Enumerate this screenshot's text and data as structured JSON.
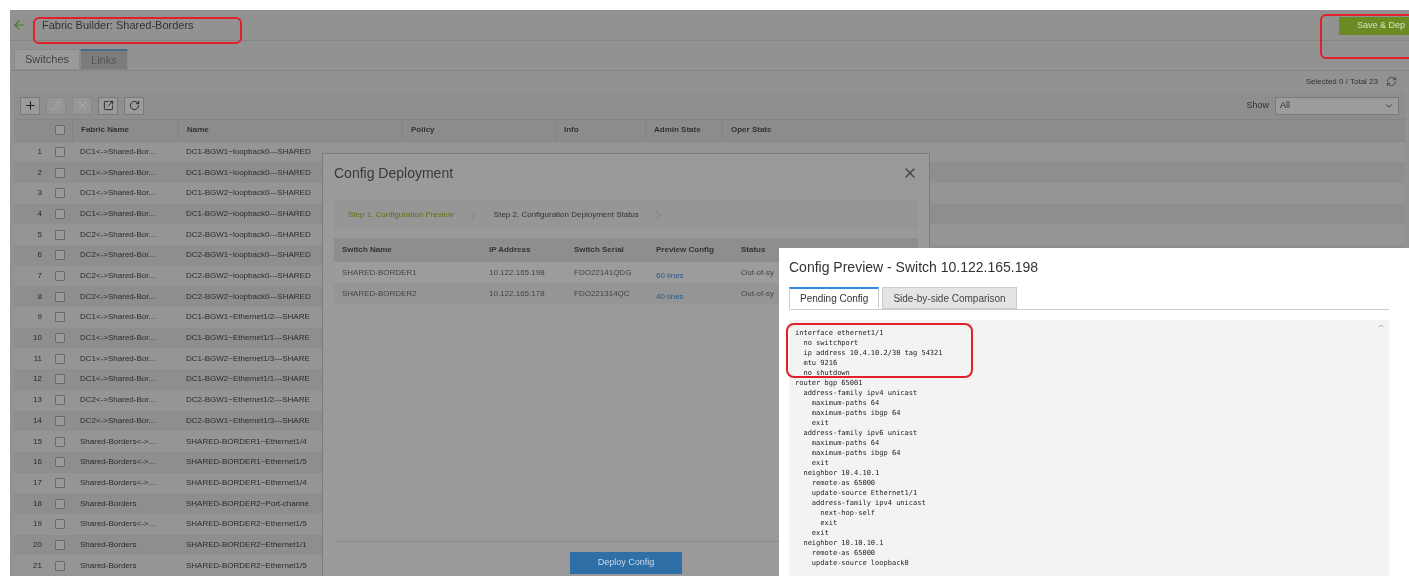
{
  "header": {
    "title": "Fabric Builder: Shared-Borders",
    "save_button": "Save & Dep"
  },
  "tabs": [
    {
      "label": "Switches",
      "selected": false
    },
    {
      "label": "Links",
      "selected": true
    }
  ],
  "summary": "Selected 0 / Total 23",
  "filter": {
    "label": "Show",
    "value": "All"
  },
  "table": {
    "columns": [
      "Fabric Name",
      "Name",
      "Policy",
      "Info",
      "Admin State",
      "Oper State"
    ],
    "select_all_checked": false,
    "rows": [
      {
        "index": "1",
        "checked": false,
        "fabric": "DC1<->Shared-Bor...",
        "name": "DC1-BGW1~loopback0---SHARED"
      },
      {
        "index": "2",
        "checked": false,
        "fabric": "DC1<->Shared-Bor...",
        "name": "DC1-BGW1~loopback0---SHARED"
      },
      {
        "index": "3",
        "checked": false,
        "fabric": "DC1<->Shared-Bor...",
        "name": "DC1-BGW2~loopback0---SHARED"
      },
      {
        "index": "4",
        "checked": false,
        "fabric": "DC1<->Shared-Bor...",
        "name": "DC1-BGW2~loopback0---SHARED"
      },
      {
        "index": "5",
        "checked": false,
        "fabric": "DC2<->Shared-Bor...",
        "name": "DC2-BGW1~loopback0---SHARED"
      },
      {
        "index": "6",
        "checked": false,
        "fabric": "DC2<->Shared-Bor...",
        "name": "DC2-BGW1~loopback0---SHARED"
      },
      {
        "index": "7",
        "checked": false,
        "fabric": "DC2<->Shared-Bor...",
        "name": "DC2-BGW2~loopback0---SHARED"
      },
      {
        "index": "8",
        "checked": false,
        "fabric": "DC2<->Shared-Bor...",
        "name": "DC2-BGW2~loopback0---SHARED"
      },
      {
        "index": "9",
        "checked": false,
        "fabric": "DC1<->Shared-Bor...",
        "name": "DC1-BGW1~Ethernet1/2---SHARE"
      },
      {
        "index": "10",
        "checked": false,
        "fabric": "DC1<->Shared-Bor...",
        "name": "DC1-BGW1~Ethernet1/1---SHARE"
      },
      {
        "index": "11",
        "checked": false,
        "fabric": "DC1<->Shared-Bor...",
        "name": "DC1-BGW2~Ethernet1/3---SHARE"
      },
      {
        "index": "12",
        "checked": false,
        "fabric": "DC1<->Shared-Bor...",
        "name": "DC1-BGW2~Ethernet1/1---SHARE"
      },
      {
        "index": "13",
        "checked": false,
        "fabric": "DC2<->Shared-Bor...",
        "name": "DC2-BGW1~Ethernet1/2---SHARE"
      },
      {
        "index": "14",
        "checked": false,
        "fabric": "DC2<->Shared-Bor...",
        "name": "DC2-BGW1~Ethernet1/3---SHARE"
      },
      {
        "index": "15",
        "checked": false,
        "fabric": "Shared-Borders<->...",
        "name": "SHARED-BORDER1~Ethernet1/4"
      },
      {
        "index": "16",
        "checked": false,
        "fabric": "Shared-Borders<->...",
        "name": "SHARED-BORDER1~Ethernet1/5"
      },
      {
        "index": "17",
        "checked": false,
        "fabric": "Shared-Borders<->...",
        "name": "SHARED-BORDER1~Ethernet1/4"
      },
      {
        "index": "18",
        "checked": false,
        "fabric": "Shared-Borders",
        "name": "SHARED-BORDER2~Port-channe"
      },
      {
        "index": "19",
        "checked": false,
        "fabric": "Shared-Borders<->...",
        "name": "SHARED-BORDER2~Ethernet1/5"
      },
      {
        "index": "20",
        "checked": false,
        "fabric": "Shared-Borders",
        "name": "SHARED-BORDER2~Ethernet1/1"
      },
      {
        "index": "21",
        "checked": false,
        "fabric": "Shared-Borders",
        "name": "SHARED-BORDER2~Ethernet1/5"
      }
    ]
  },
  "deployment_dialog": {
    "title": "Config Deployment",
    "steps": [
      {
        "label": "Step 1. Configuration Preview",
        "selected": true
      },
      {
        "label": "Step 2. Configuration Deployment Status",
        "selected": false
      }
    ],
    "columns": [
      "Switch Name",
      "IP Address",
      "Switch Serial",
      "Preview Config",
      "Status"
    ],
    "rows": [
      {
        "switch": "SHARED-BORDER1",
        "ip": "10.122.165.198",
        "serial": "FDO22141QDG",
        "preview": "60 lines",
        "status": "Out-of-sy"
      },
      {
        "switch": "SHARED-BORDER2",
        "ip": "10.122.165.178",
        "serial": "FDO221314QC",
        "preview": "40 lines",
        "status": "Out-of-sy"
      }
    ],
    "deploy_button": "Deploy Config"
  },
  "preview_dialog": {
    "title": "Config Preview - Switch 10.122.165.198",
    "tabs": [
      {
        "label": "Pending Config",
        "selected": true
      },
      {
        "label": "Side-by-side Comparison",
        "selected": false
      }
    ],
    "config_lines": [
      "interface ethernet1/1",
      "  no switchport",
      "  ip address 10.4.10.2/30 tag 54321",
      "  mtu 9216",
      "  no shutdown",
      "router bgp 65001",
      "  address-family ipv4 unicast",
      "    maximum-paths 64",
      "    maximum-paths ibgp 64",
      "    exit",
      "  address-family ipv6 unicast",
      "    maximum-paths 64",
      "    maximum-paths ibgp 64",
      "    exit",
      "  neighbor 10.4.10.1",
      "    remote-as 65000",
      "    update-source Ethernet1/1",
      "    address-family ipv4 unicast",
      "      next-hop-self",
      "      exit",
      "    exit",
      "  neighbor 10.10.10.1",
      "    remote-as 65000",
      "    update-source loopback0"
    ]
  }
}
